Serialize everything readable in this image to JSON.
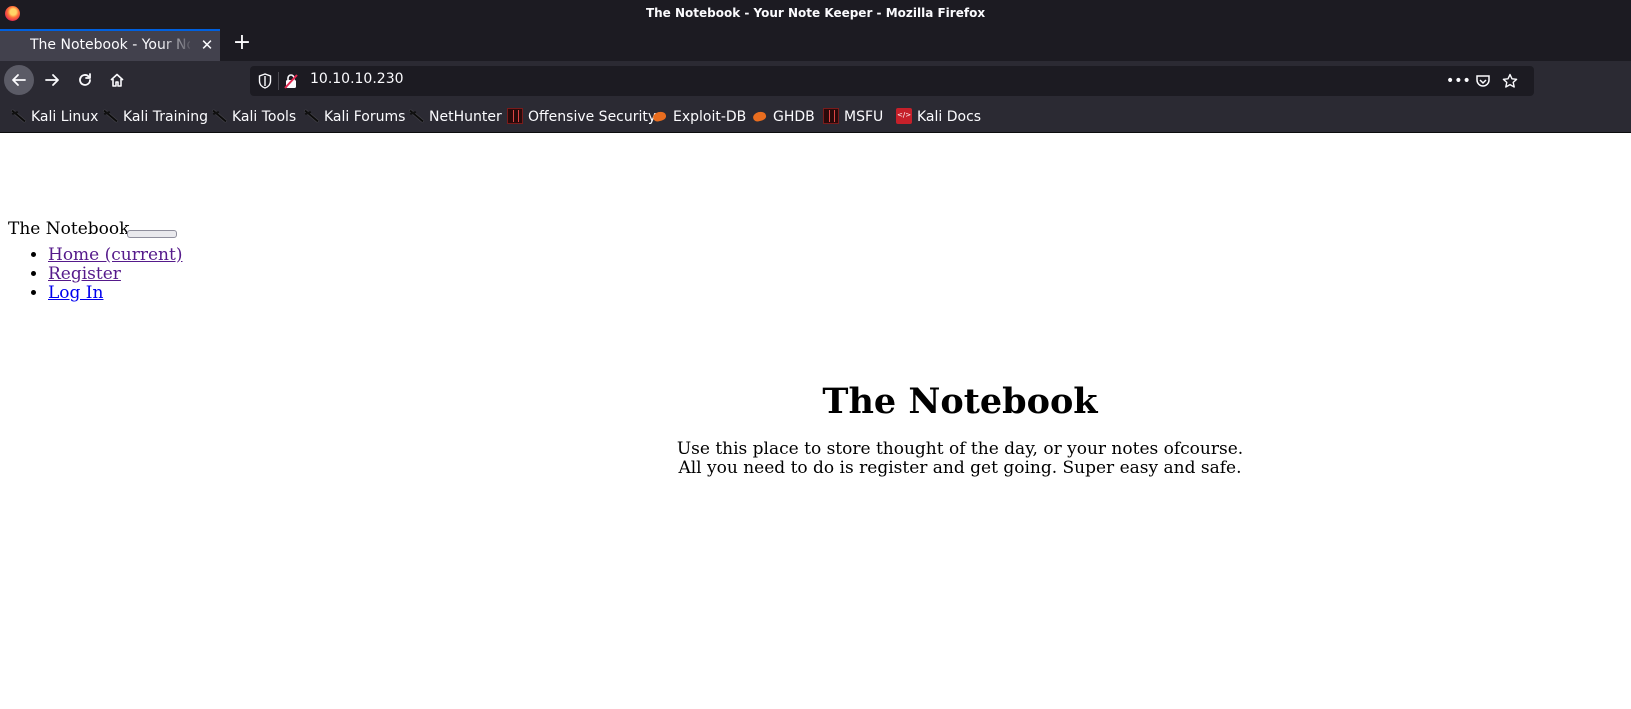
{
  "window": {
    "title": "The Notebook - Your Note Keeper - Mozilla Firefox"
  },
  "tabs": [
    {
      "title": "The Notebook - Your Note Keeper",
      "active": true
    }
  ],
  "new_tab_label": "+",
  "close_label": "✕",
  "urlbar": {
    "url": "10.10.10.230"
  },
  "bookmarks": [
    {
      "label": "Kali Linux",
      "icon": "kali-dragon-icon"
    },
    {
      "label": "Kali Training",
      "icon": "kali-dragon-icon"
    },
    {
      "label": "Kali Tools",
      "icon": "kali-dragon-icon"
    },
    {
      "label": "Kali Forums",
      "icon": "kali-dragon-icon"
    },
    {
      "label": "NetHunter",
      "icon": "kali-dragon-icon"
    },
    {
      "label": "Offensive Security",
      "icon": "offsec-icon"
    },
    {
      "label": "Exploit-DB",
      "icon": "exploit-db-icon"
    },
    {
      "label": "GHDB",
      "icon": "exploit-db-icon"
    },
    {
      "label": "MSFU",
      "icon": "offsec-icon"
    },
    {
      "label": "Kali Docs",
      "icon": "kali-docs-icon"
    }
  ],
  "page": {
    "brand": "The Notebook",
    "nav": [
      {
        "label": "Home (current)",
        "visited": true
      },
      {
        "label": "Register",
        "visited": true
      },
      {
        "label": "Log In",
        "visited": false
      }
    ],
    "hero": {
      "heading": "The Notebook",
      "line1": "Use this place to store thought of the day, or your notes ofcourse.",
      "line2": "All you need to do is register and get going. Super easy and safe."
    }
  },
  "colors": {
    "chrome_dark": "#1c1b22",
    "toolbar": "#2b2a33",
    "active_tab": "#42414d",
    "tab_accent": "#0060df",
    "link_visited": "#551a8b",
    "link_unvisited": "#0000ee"
  }
}
